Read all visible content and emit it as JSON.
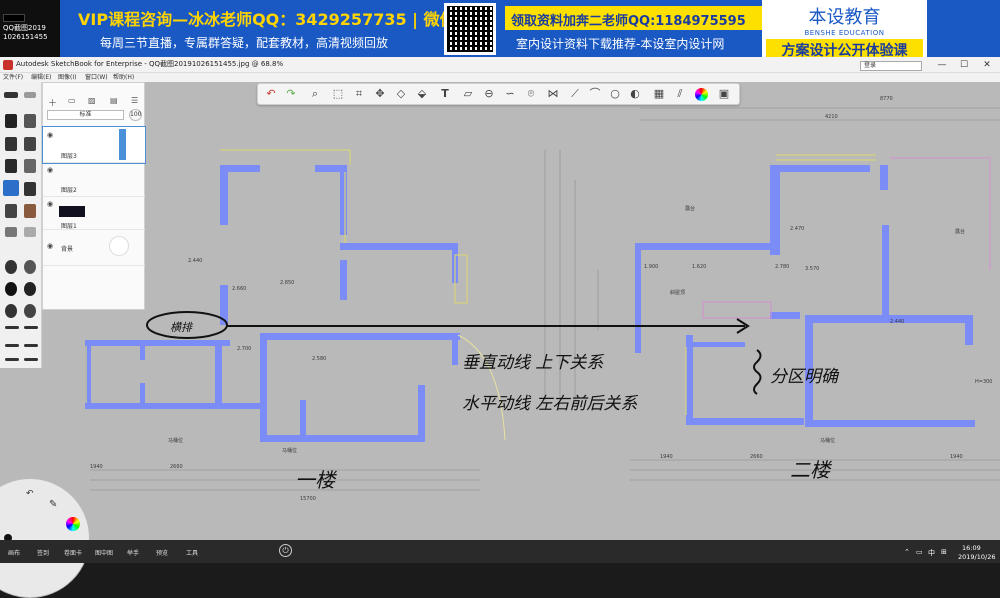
{
  "banner": {
    "qq_title": "QQ截图2019",
    "qq_sub": "1026151455",
    "vip_text": "VIP课程咨询—冰冰老师QQ：3429257735 | 微信",
    "weekly_text": "每周三节直播，专属群答疑，配套教材，高清视频回放",
    "lingqu_text": "领取资料加奔二老师QQ:1184975595",
    "download_text": "室内设计资料下载推荐-本设室内设计网",
    "logo_title": "本设教育",
    "logo_en": "BENSHE EDUCATION",
    "logo_course": "方案设计公开体验课"
  },
  "window": {
    "title": "Autodesk SketchBook for Enterprise - QQ截图20191026151455.jpg @ 68.8%",
    "minimize": "—",
    "maximize": "☐",
    "close": "✕",
    "user_label": "登录"
  },
  "menu": [
    "文件(F)",
    "编辑(E)",
    "图像(I)",
    "窗口(W)",
    "帮助(H)"
  ],
  "layers_panel": {
    "blend_mode": "标准",
    "opacity": "100",
    "layers": [
      {
        "name": "图层3"
      },
      {
        "name": "图层2"
      },
      {
        "name": "图层1"
      },
      {
        "name": "背景"
      }
    ]
  },
  "annotations": {
    "arrow_label": "横排",
    "vertical_note": "垂直动线 上下关系",
    "horizontal_note": "水平动线 左右前后关系",
    "zone_note": "分区明确",
    "floor_one": "一楼",
    "floor_two": "二楼"
  },
  "bottom_tabs": [
    "画布",
    "签到",
    "卷面卡",
    "图中图",
    "举手",
    "预览",
    "工具"
  ],
  "taskbar": {
    "time": "16:09",
    "date": "2019/10/26",
    "ime": "中"
  },
  "colors": {
    "banner_blue": "#1a59c4",
    "banner_yellow": "#fde000",
    "wall_blue": "#7c8cf6",
    "canvas_gray": "#b9b9b9"
  }
}
